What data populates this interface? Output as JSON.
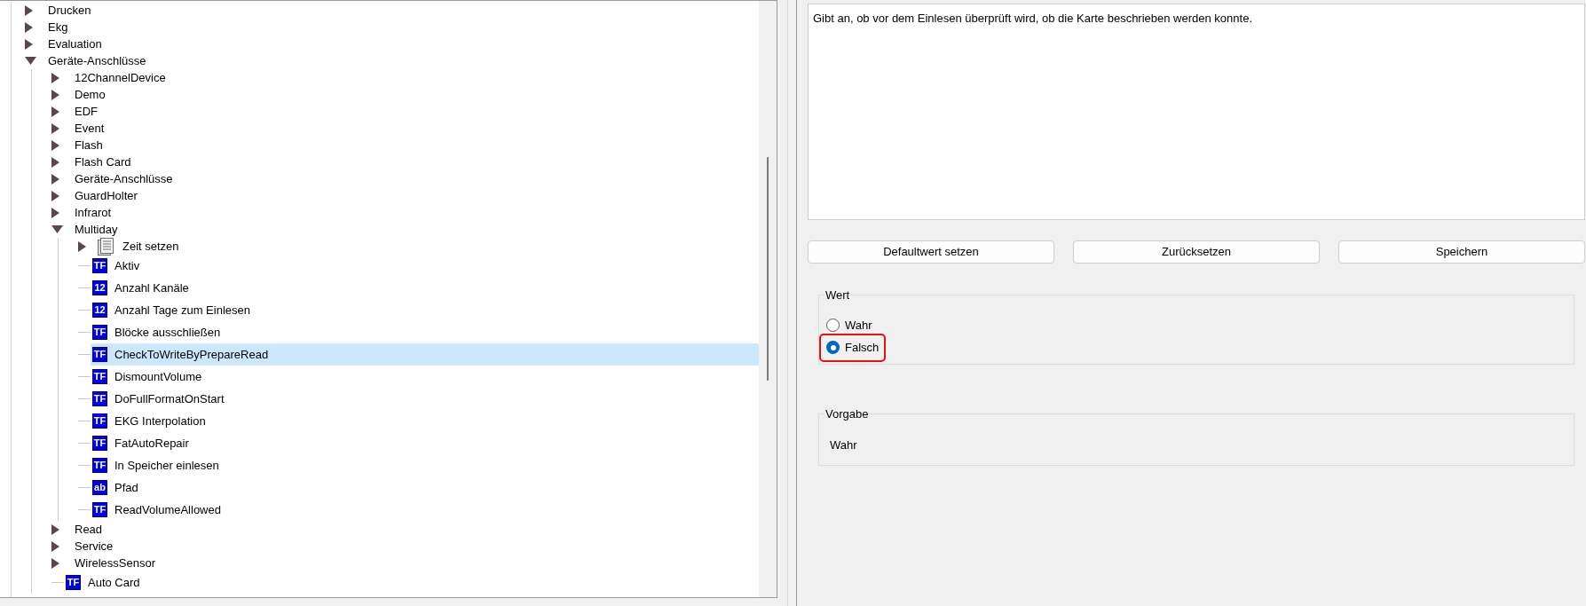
{
  "tree": {
    "items": [
      {
        "label": "Drucken",
        "kind": "group",
        "expanded": false,
        "selected": false
      },
      {
        "label": "Ekg",
        "kind": "group",
        "expanded": false,
        "selected": false
      },
      {
        "label": "Evaluation",
        "kind": "group",
        "expanded": false,
        "selected": false
      },
      {
        "label": "Geräte-Anschlüsse",
        "kind": "group",
        "expanded": true,
        "selected": false,
        "children": [
          {
            "label": "12ChannelDevice",
            "kind": "group",
            "expanded": false,
            "selected": false
          },
          {
            "label": "Demo",
            "kind": "group",
            "expanded": false,
            "selected": false
          },
          {
            "label": "EDF",
            "kind": "group",
            "expanded": false,
            "selected": false
          },
          {
            "label": "Event",
            "kind": "group",
            "expanded": false,
            "selected": false
          },
          {
            "label": "Flash",
            "kind": "group",
            "expanded": false,
            "selected": false
          },
          {
            "label": "Flash Card",
            "kind": "group",
            "expanded": false,
            "selected": false
          },
          {
            "label": "Geräte-Anschlüsse",
            "kind": "group",
            "expanded": false,
            "selected": false
          },
          {
            "label": "GuardHolter",
            "kind": "group",
            "expanded": false,
            "selected": false
          },
          {
            "label": "Infrarot",
            "kind": "group",
            "expanded": false,
            "selected": false
          },
          {
            "label": "Multiday",
            "kind": "group",
            "expanded": true,
            "selected": false,
            "children": [
              {
                "label": "Zeit setzen",
                "kind": "page",
                "expanded": false,
                "selected": false
              },
              {
                "label": "Aktiv",
                "kind": "setting",
                "badge": "TF",
                "selected": false
              },
              {
                "label": "Anzahl Kanäle",
                "kind": "setting",
                "badge": "12",
                "selected": false
              },
              {
                "label": "Anzahl Tage zum Einlesen",
                "kind": "setting",
                "badge": "12",
                "selected": false
              },
              {
                "label": "Blöcke ausschließen",
                "kind": "setting",
                "badge": "TF",
                "selected": false
              },
              {
                "label": "CheckToWriteByPrepareRead",
                "kind": "setting",
                "badge": "TF",
                "selected": true
              },
              {
                "label": "DismountVolume",
                "kind": "setting",
                "badge": "TF",
                "selected": false
              },
              {
                "label": "DoFullFormatOnStart",
                "kind": "setting",
                "badge": "TF",
                "selected": false
              },
              {
                "label": "EKG Interpolation",
                "kind": "setting",
                "badge": "TF",
                "selected": false
              },
              {
                "label": "FatAutoRepair",
                "kind": "setting",
                "badge": "TF",
                "selected": false
              },
              {
                "label": "In Speicher einlesen",
                "kind": "setting",
                "badge": "TF",
                "selected": false
              },
              {
                "label": "Pfad",
                "kind": "setting",
                "badge": "ab",
                "selected": false
              },
              {
                "label": "ReadVolumeAllowed",
                "kind": "setting",
                "badge": "TF",
                "selected": false
              }
            ]
          },
          {
            "label": "Read",
            "kind": "group",
            "expanded": false,
            "selected": false
          },
          {
            "label": "Service",
            "kind": "group",
            "expanded": false,
            "selected": false
          },
          {
            "label": "WirelessSensor",
            "kind": "group",
            "expanded": false,
            "selected": false
          },
          {
            "label": "Auto Card",
            "kind": "setting",
            "badge": "TF",
            "selected": false
          }
        ]
      }
    ]
  },
  "description": "Gibt an, ob vor dem Einlesen überprüft wird, ob die Karte beschrieben werden konnte.",
  "buttons": [
    "Defaultwert setzen",
    "Zurücksetzen",
    "Speichern"
  ],
  "value_group": {
    "title": "Wert",
    "options": [
      {
        "label": "Wahr",
        "selected": false,
        "highlighted": false
      },
      {
        "label": "Falsch",
        "selected": true,
        "highlighted": true
      }
    ]
  },
  "default_group": {
    "title": "Vorgabe",
    "value": "Wahr"
  }
}
